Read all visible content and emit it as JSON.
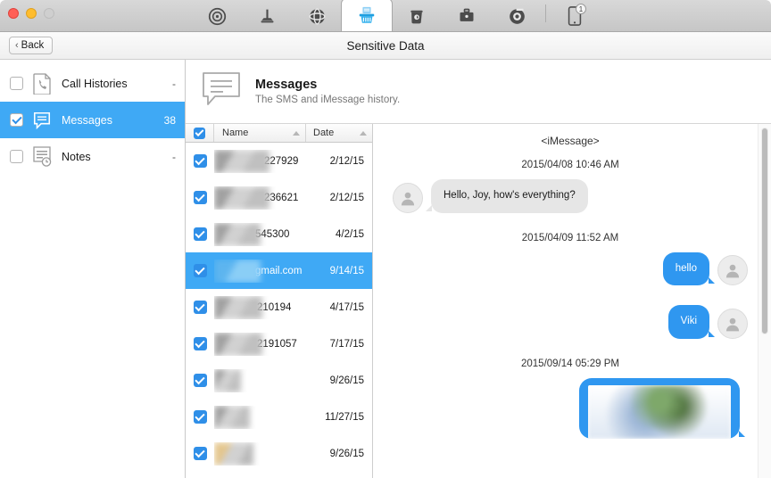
{
  "window": {
    "traffic_lights": [
      "close",
      "minimize",
      "zoom"
    ]
  },
  "toolbar": {
    "tabs": [
      {
        "name": "radar-icon",
        "label": "Radar"
      },
      {
        "name": "plunger-icon",
        "label": "Clean Up"
      },
      {
        "name": "sphere-icon",
        "label": "Privacy"
      },
      {
        "name": "shred-basket-icon",
        "label": "Sensitive Data",
        "active": true
      },
      {
        "name": "trash-icon",
        "label": "Trash"
      },
      {
        "name": "toolbox-icon",
        "label": "Toolkit"
      },
      {
        "name": "target-icon",
        "label": "Target"
      }
    ],
    "device": {
      "name": "phone-icon",
      "badge": "1"
    }
  },
  "navbar": {
    "back_label": "Back",
    "title": "Sensitive Data"
  },
  "sidebar": {
    "items": [
      {
        "label": "Call Histories",
        "count": "-",
        "icon": "call-history-icon",
        "checked": false,
        "selected": false
      },
      {
        "label": "Messages",
        "count": "38",
        "icon": "messages-icon",
        "checked": true,
        "selected": true
      },
      {
        "label": "Notes",
        "count": "-",
        "icon": "notes-icon",
        "checked": false,
        "selected": false
      }
    ]
  },
  "header_panel": {
    "icon": "messages-bubble-icon",
    "title": "Messages",
    "subtitle": "The SMS and iMessage history."
  },
  "list": {
    "header": {
      "select_all_checked": true,
      "columns": [
        {
          "label": "Name",
          "sort": "asc"
        },
        {
          "label": "Date",
          "sort": "asc"
        }
      ]
    },
    "rows": [
      {
        "name_redacted": true,
        "name_tail": "227929",
        "date": "2/12/15",
        "checked": true,
        "selected": false,
        "blur_w": 62,
        "hue": "gray"
      },
      {
        "name_redacted": true,
        "name_tail": "236621",
        "date": "2/12/15",
        "checked": true,
        "selected": false,
        "blur_w": 62,
        "hue": "gray"
      },
      {
        "name_redacted": true,
        "name_tail": "545300",
        "date": "4/2/15",
        "checked": true,
        "selected": false,
        "blur_w": 52,
        "hue": "gray"
      },
      {
        "name_redacted": true,
        "name_tail": "gmail.com",
        "date": "9/14/15",
        "checked": true,
        "selected": true,
        "blur_w": 52,
        "hue": "blue"
      },
      {
        "name_redacted": true,
        "name_tail": "210194",
        "date": "4/17/15",
        "checked": true,
        "selected": false,
        "blur_w": 54,
        "hue": "gray"
      },
      {
        "name_redacted": true,
        "name_tail": "2191057",
        "date": "7/17/15",
        "checked": true,
        "selected": false,
        "blur_w": 54,
        "hue": "gray"
      },
      {
        "name_redacted": true,
        "name_tail": "",
        "date": "9/26/15",
        "checked": true,
        "selected": false,
        "blur_w": 30,
        "hue": "gray"
      },
      {
        "name_redacted": true,
        "name_tail": "",
        "date": "11/27/15",
        "checked": true,
        "selected": false,
        "blur_w": 40,
        "hue": "gray"
      },
      {
        "name_redacted": true,
        "name_tail": "",
        "date": "9/26/15",
        "checked": true,
        "selected": false,
        "blur_w": 44,
        "hue": "tan"
      }
    ]
  },
  "conversation": {
    "service_label": "<iMessage>",
    "entries": [
      {
        "kind": "timestamp",
        "text": "2015/04/08 10:46 AM"
      },
      {
        "kind": "message",
        "direction": "incoming",
        "text": "Hello, Joy, how's everything?"
      },
      {
        "kind": "timestamp",
        "text": "2015/04/09 11:52 AM"
      },
      {
        "kind": "message",
        "direction": "outgoing",
        "text": "hello"
      },
      {
        "kind": "message",
        "direction": "outgoing",
        "text": "Viki"
      },
      {
        "kind": "timestamp",
        "text": "2015/09/14 05:29 PM"
      },
      {
        "kind": "photo",
        "direction": "outgoing",
        "text": ""
      }
    ]
  },
  "colors": {
    "accent": "#3fa9f5",
    "bubble_out": "#2f97f0",
    "bubble_in": "#e6e6e6",
    "checkbox": "#2f8fe8"
  }
}
